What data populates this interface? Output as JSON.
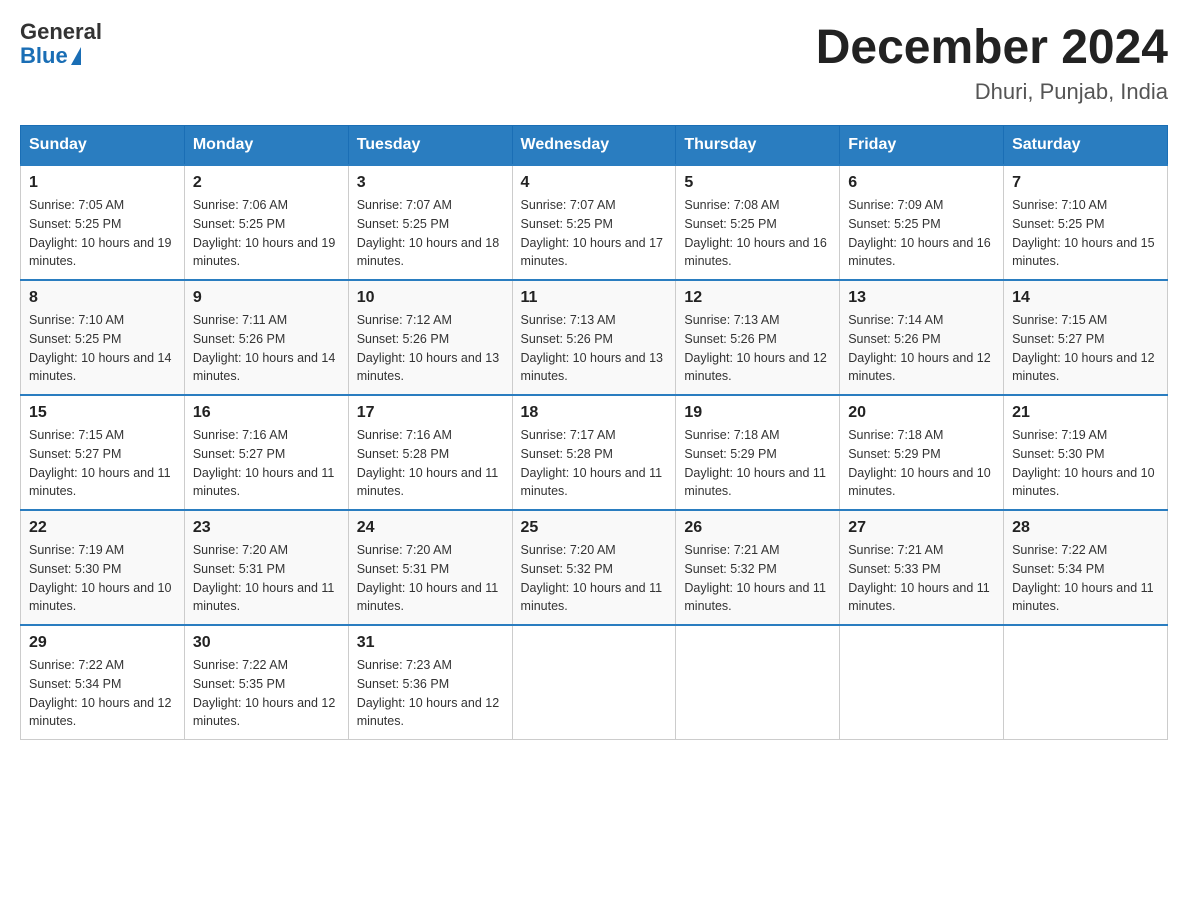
{
  "logo": {
    "general": "General",
    "blue": "Blue"
  },
  "title": "December 2024",
  "subtitle": "Dhuri, Punjab, India",
  "headers": [
    "Sunday",
    "Monday",
    "Tuesday",
    "Wednesday",
    "Thursday",
    "Friday",
    "Saturday"
  ],
  "weeks": [
    [
      {
        "day": "1",
        "sunrise": "7:05 AM",
        "sunset": "5:25 PM",
        "daylight": "10 hours and 19 minutes."
      },
      {
        "day": "2",
        "sunrise": "7:06 AM",
        "sunset": "5:25 PM",
        "daylight": "10 hours and 19 minutes."
      },
      {
        "day": "3",
        "sunrise": "7:07 AM",
        "sunset": "5:25 PM",
        "daylight": "10 hours and 18 minutes."
      },
      {
        "day": "4",
        "sunrise": "7:07 AM",
        "sunset": "5:25 PM",
        "daylight": "10 hours and 17 minutes."
      },
      {
        "day": "5",
        "sunrise": "7:08 AM",
        "sunset": "5:25 PM",
        "daylight": "10 hours and 16 minutes."
      },
      {
        "day": "6",
        "sunrise": "7:09 AM",
        "sunset": "5:25 PM",
        "daylight": "10 hours and 16 minutes."
      },
      {
        "day": "7",
        "sunrise": "7:10 AM",
        "sunset": "5:25 PM",
        "daylight": "10 hours and 15 minutes."
      }
    ],
    [
      {
        "day": "8",
        "sunrise": "7:10 AM",
        "sunset": "5:25 PM",
        "daylight": "10 hours and 14 minutes."
      },
      {
        "day": "9",
        "sunrise": "7:11 AM",
        "sunset": "5:26 PM",
        "daylight": "10 hours and 14 minutes."
      },
      {
        "day": "10",
        "sunrise": "7:12 AM",
        "sunset": "5:26 PM",
        "daylight": "10 hours and 13 minutes."
      },
      {
        "day": "11",
        "sunrise": "7:13 AM",
        "sunset": "5:26 PM",
        "daylight": "10 hours and 13 minutes."
      },
      {
        "day": "12",
        "sunrise": "7:13 AM",
        "sunset": "5:26 PM",
        "daylight": "10 hours and 12 minutes."
      },
      {
        "day": "13",
        "sunrise": "7:14 AM",
        "sunset": "5:26 PM",
        "daylight": "10 hours and 12 minutes."
      },
      {
        "day": "14",
        "sunrise": "7:15 AM",
        "sunset": "5:27 PM",
        "daylight": "10 hours and 12 minutes."
      }
    ],
    [
      {
        "day": "15",
        "sunrise": "7:15 AM",
        "sunset": "5:27 PM",
        "daylight": "10 hours and 11 minutes."
      },
      {
        "day": "16",
        "sunrise": "7:16 AM",
        "sunset": "5:27 PM",
        "daylight": "10 hours and 11 minutes."
      },
      {
        "day": "17",
        "sunrise": "7:16 AM",
        "sunset": "5:28 PM",
        "daylight": "10 hours and 11 minutes."
      },
      {
        "day": "18",
        "sunrise": "7:17 AM",
        "sunset": "5:28 PM",
        "daylight": "10 hours and 11 minutes."
      },
      {
        "day": "19",
        "sunrise": "7:18 AM",
        "sunset": "5:29 PM",
        "daylight": "10 hours and 11 minutes."
      },
      {
        "day": "20",
        "sunrise": "7:18 AM",
        "sunset": "5:29 PM",
        "daylight": "10 hours and 10 minutes."
      },
      {
        "day": "21",
        "sunrise": "7:19 AM",
        "sunset": "5:30 PM",
        "daylight": "10 hours and 10 minutes."
      }
    ],
    [
      {
        "day": "22",
        "sunrise": "7:19 AM",
        "sunset": "5:30 PM",
        "daylight": "10 hours and 10 minutes."
      },
      {
        "day": "23",
        "sunrise": "7:20 AM",
        "sunset": "5:31 PM",
        "daylight": "10 hours and 11 minutes."
      },
      {
        "day": "24",
        "sunrise": "7:20 AM",
        "sunset": "5:31 PM",
        "daylight": "10 hours and 11 minutes."
      },
      {
        "day": "25",
        "sunrise": "7:20 AM",
        "sunset": "5:32 PM",
        "daylight": "10 hours and 11 minutes."
      },
      {
        "day": "26",
        "sunrise": "7:21 AM",
        "sunset": "5:32 PM",
        "daylight": "10 hours and 11 minutes."
      },
      {
        "day": "27",
        "sunrise": "7:21 AM",
        "sunset": "5:33 PM",
        "daylight": "10 hours and 11 minutes."
      },
      {
        "day": "28",
        "sunrise": "7:22 AM",
        "sunset": "5:34 PM",
        "daylight": "10 hours and 11 minutes."
      }
    ],
    [
      {
        "day": "29",
        "sunrise": "7:22 AM",
        "sunset": "5:34 PM",
        "daylight": "10 hours and 12 minutes."
      },
      {
        "day": "30",
        "sunrise": "7:22 AM",
        "sunset": "5:35 PM",
        "daylight": "10 hours and 12 minutes."
      },
      {
        "day": "31",
        "sunrise": "7:23 AM",
        "sunset": "5:36 PM",
        "daylight": "10 hours and 12 minutes."
      },
      null,
      null,
      null,
      null
    ]
  ]
}
